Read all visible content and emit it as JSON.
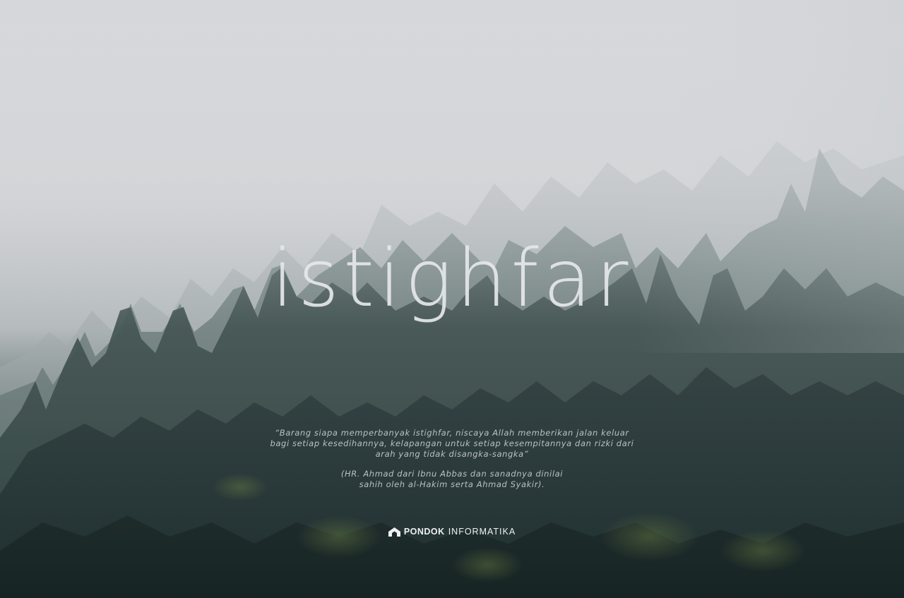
{
  "poster": {
    "title": "istighfar",
    "quote_line_1": "“Barang siapa memperbanyak istighfar, niscaya Allah memberikan jalan keluar",
    "quote_line_2": "bagi setiap kesedihannya, kelapangan untuk setiap kesempitannya dan rizki dari",
    "quote_line_3": "arah yang tidak disangka-sangka”",
    "reference_line_1": "(HR. Ahmad dari Ibnu Abbas dan sanadnya dinilai",
    "reference_line_2": "sahih oleh al-Hakim serta Ahmad Syakir).",
    "brand_bold": "PONDOK",
    "brand_light": "INFORMATIKA",
    "brand_icon": "pondok-roof-icon"
  },
  "colors": {
    "fog": "#d9dadd",
    "forest_dark": "#1c2a2b",
    "forest_mid": "#2f4443",
    "text": "#e6e8ea"
  }
}
